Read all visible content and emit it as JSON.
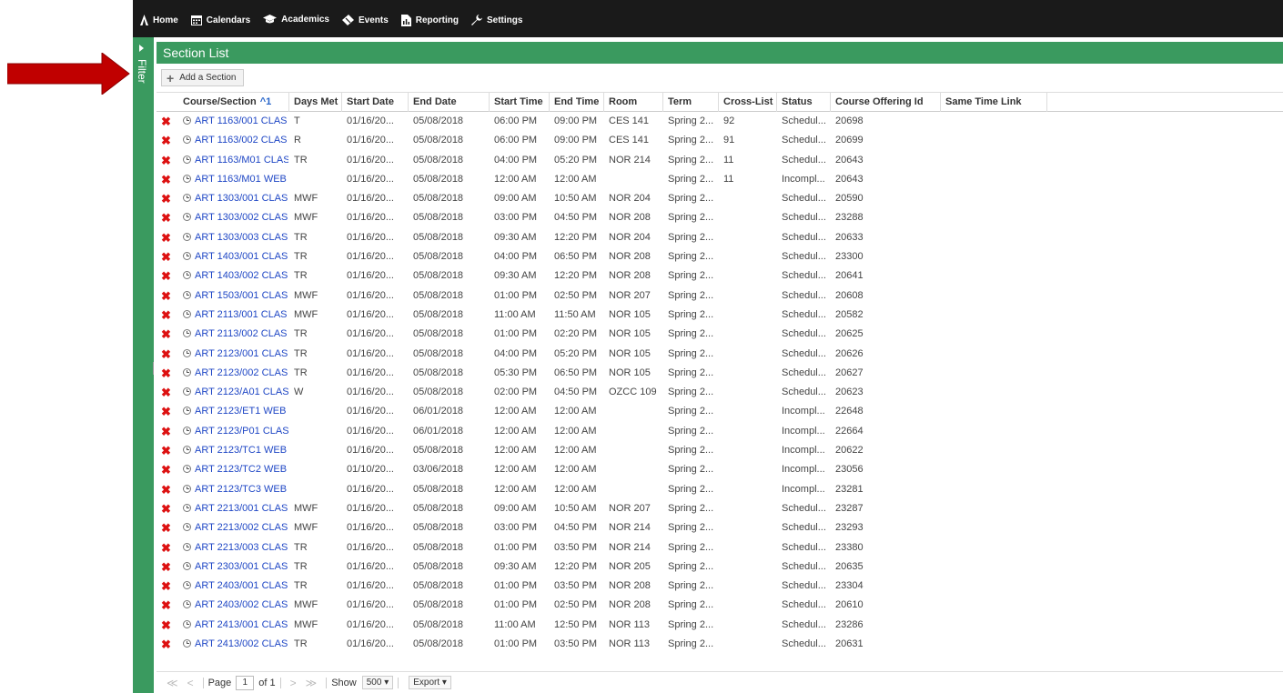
{
  "nav": {
    "items": [
      {
        "label": "Home",
        "icon": "home-icon"
      },
      {
        "label": "Calendars",
        "icon": "calendar-icon"
      },
      {
        "label": "Academics",
        "icon": "graduation-cap-icon"
      },
      {
        "label": "Events",
        "icon": "ticket-icon"
      },
      {
        "label": "Reporting",
        "icon": "report-icon"
      },
      {
        "label": "Settings",
        "icon": "wrench-icon"
      }
    ]
  },
  "filter": {
    "label": "Filter"
  },
  "header": {
    "title": "Section List"
  },
  "toolbar": {
    "add_label": "Add a Section"
  },
  "colors": {
    "accent": "#3a9a5f",
    "nav_bg": "#1a1a1a",
    "arrow": "#c00000",
    "link": "#1f47c5",
    "delete": "#dd1111"
  },
  "table": {
    "columns": [
      "Course/Section",
      "Days Met",
      "Start Date",
      "End Date",
      "Start Time",
      "End Time",
      "Room",
      "Term",
      "Cross-List",
      "Status",
      "Course Offering Id",
      "Same Time Link"
    ],
    "sort_indicator": "^1",
    "rows": [
      [
        "ART 1163/001 CLAS",
        "T",
        "01/16/20...",
        "05/08/2018",
        "06:00 PM",
        "09:00 PM",
        "CES 141",
        "Spring 2...",
        "92",
        "Schedul...",
        "20698",
        ""
      ],
      [
        "ART 1163/002 CLAS",
        "R",
        "01/16/20...",
        "05/08/2018",
        "06:00 PM",
        "09:00 PM",
        "CES 141",
        "Spring 2...",
        "91",
        "Schedul...",
        "20699",
        ""
      ],
      [
        "ART 1163/M01 CLAS",
        "TR",
        "01/16/20...",
        "05/08/2018",
        "04:00 PM",
        "05:20 PM",
        "NOR 214",
        "Spring 2...",
        "11",
        "Schedul...",
        "20643",
        ""
      ],
      [
        "ART 1163/M01 WEB",
        "",
        "01/16/20...",
        "05/08/2018",
        "12:00 AM",
        "12:00 AM",
        "",
        "Spring 2...",
        "11",
        "Incompl...",
        "20643",
        ""
      ],
      [
        "ART 1303/001 CLAS",
        "MWF",
        "01/16/20...",
        "05/08/2018",
        "09:00 AM",
        "10:50 AM",
        "NOR 204",
        "Spring 2...",
        "",
        "Schedul...",
        "20590",
        ""
      ],
      [
        "ART 1303/002 CLAS",
        "MWF",
        "01/16/20...",
        "05/08/2018",
        "03:00 PM",
        "04:50 PM",
        "NOR 208",
        "Spring 2...",
        "",
        "Schedul...",
        "23288",
        ""
      ],
      [
        "ART 1303/003 CLAS",
        "TR",
        "01/16/20...",
        "05/08/2018",
        "09:30 AM",
        "12:20 PM",
        "NOR 204",
        "Spring 2...",
        "",
        "Schedul...",
        "20633",
        ""
      ],
      [
        "ART 1403/001 CLAS",
        "TR",
        "01/16/20...",
        "05/08/2018",
        "04:00 PM",
        "06:50 PM",
        "NOR 208",
        "Spring 2...",
        "",
        "Schedul...",
        "23300",
        ""
      ],
      [
        "ART 1403/002 CLAS",
        "TR",
        "01/16/20...",
        "05/08/2018",
        "09:30 AM",
        "12:20 PM",
        "NOR 208",
        "Spring 2...",
        "",
        "Schedul...",
        "20641",
        ""
      ],
      [
        "ART 1503/001 CLAS",
        "MWF",
        "01/16/20...",
        "05/08/2018",
        "01:00 PM",
        "02:50 PM",
        "NOR 207",
        "Spring 2...",
        "",
        "Schedul...",
        "20608",
        ""
      ],
      [
        "ART 2113/001 CLAS",
        "MWF",
        "01/16/20...",
        "05/08/2018",
        "11:00 AM",
        "11:50 AM",
        "NOR 105",
        "Spring 2...",
        "",
        "Schedul...",
        "20582",
        ""
      ],
      [
        "ART 2113/002 CLAS",
        "TR",
        "01/16/20...",
        "05/08/2018",
        "01:00 PM",
        "02:20 PM",
        "NOR 105",
        "Spring 2...",
        "",
        "Schedul...",
        "20625",
        ""
      ],
      [
        "ART 2123/001 CLAS",
        "TR",
        "01/16/20...",
        "05/08/2018",
        "04:00 PM",
        "05:20 PM",
        "NOR 105",
        "Spring 2...",
        "",
        "Schedul...",
        "20626",
        ""
      ],
      [
        "ART 2123/002 CLAS",
        "TR",
        "01/16/20...",
        "05/08/2018",
        "05:30 PM",
        "06:50 PM",
        "NOR 105",
        "Spring 2...",
        "",
        "Schedul...",
        "20627",
        ""
      ],
      [
        "ART 2123/A01 CLAS",
        "W",
        "01/16/20...",
        "05/08/2018",
        "02:00 PM",
        "04:50 PM",
        "OZCC 109",
        "Spring 2...",
        "",
        "Schedul...",
        "20623",
        ""
      ],
      [
        "ART 2123/ET1 WEB",
        "",
        "01/16/20...",
        "06/01/2018",
        "12:00 AM",
        "12:00 AM",
        "",
        "Spring 2...",
        "",
        "Incompl...",
        "22648",
        ""
      ],
      [
        "ART 2123/P01 CLAS",
        "",
        "01/16/20...",
        "06/01/2018",
        "12:00 AM",
        "12:00 AM",
        "",
        "Spring 2...",
        "",
        "Incompl...",
        "22664",
        ""
      ],
      [
        "ART 2123/TC1 WEB",
        "",
        "01/16/20...",
        "05/08/2018",
        "12:00 AM",
        "12:00 AM",
        "",
        "Spring 2...",
        "",
        "Incompl...",
        "20622",
        ""
      ],
      [
        "ART 2123/TC2 WEB",
        "",
        "01/10/20...",
        "03/06/2018",
        "12:00 AM",
        "12:00 AM",
        "",
        "Spring 2...",
        "",
        "Incompl...",
        "23056",
        ""
      ],
      [
        "ART 2123/TC3 WEB",
        "",
        "01/16/20...",
        "05/08/2018",
        "12:00 AM",
        "12:00 AM",
        "",
        "Spring 2...",
        "",
        "Incompl...",
        "23281",
        ""
      ],
      [
        "ART 2213/001 CLAS",
        "MWF",
        "01/16/20...",
        "05/08/2018",
        "09:00 AM",
        "10:50 AM",
        "NOR 207",
        "Spring 2...",
        "",
        "Schedul...",
        "23287",
        ""
      ],
      [
        "ART 2213/002 CLAS",
        "MWF",
        "01/16/20...",
        "05/08/2018",
        "03:00 PM",
        "04:50 PM",
        "NOR 214",
        "Spring 2...",
        "",
        "Schedul...",
        "23293",
        ""
      ],
      [
        "ART 2213/003 CLAS",
        "TR",
        "01/16/20...",
        "05/08/2018",
        "01:00 PM",
        "03:50 PM",
        "NOR 214",
        "Spring 2...",
        "",
        "Schedul...",
        "23380",
        ""
      ],
      [
        "ART 2303/001 CLAS",
        "TR",
        "01/16/20...",
        "05/08/2018",
        "09:30 AM",
        "12:20 PM",
        "NOR 205",
        "Spring 2...",
        "",
        "Schedul...",
        "20635",
        ""
      ],
      [
        "ART 2403/001 CLAS",
        "TR",
        "01/16/20...",
        "05/08/2018",
        "01:00 PM",
        "03:50 PM",
        "NOR 208",
        "Spring 2...",
        "",
        "Schedul...",
        "23304",
        ""
      ],
      [
        "ART 2403/002 CLAS",
        "MWF",
        "01/16/20...",
        "05/08/2018",
        "01:00 PM",
        "02:50 PM",
        "NOR 208",
        "Spring 2...",
        "",
        "Schedul...",
        "20610",
        ""
      ],
      [
        "ART 2413/001 CLAS",
        "MWF",
        "01/16/20...",
        "05/08/2018",
        "11:00 AM",
        "12:50 PM",
        "NOR 113",
        "Spring 2...",
        "",
        "Schedul...",
        "23286",
        ""
      ],
      [
        "ART 2413/002 CLAS",
        "TR",
        "01/16/20...",
        "05/08/2018",
        "01:00 PM",
        "03:50 PM",
        "NOR 113",
        "Spring 2...",
        "",
        "Schedul...",
        "20631",
        ""
      ]
    ]
  },
  "pager": {
    "page_label": "Page",
    "page_value": "1",
    "of_label": "of 1",
    "show_label": "Show",
    "page_size": "500",
    "export_label": "Export"
  }
}
